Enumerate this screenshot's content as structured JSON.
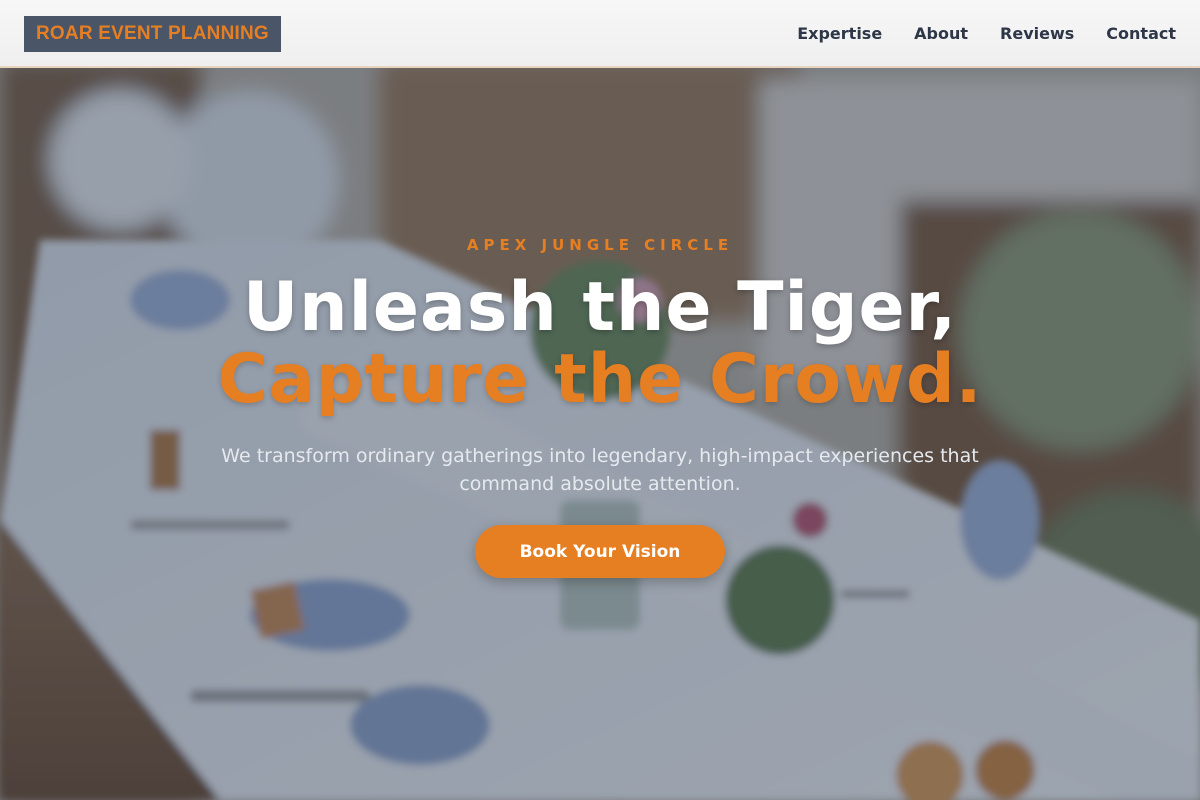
{
  "header": {
    "logo_text": "ROAR EVENT PLANNING",
    "nav": [
      {
        "label": "Expertise"
      },
      {
        "label": "About"
      },
      {
        "label": "Reviews"
      },
      {
        "label": "Contact"
      }
    ]
  },
  "hero": {
    "eyebrow": "APEX JUNGLE CIRCLE",
    "headline_line1": "Unleash the Tiger,",
    "headline_line2": "Capture the Crowd.",
    "subtitle": "We transform ordinary gatherings into legendary, high-impact experiences that command absolute attention.",
    "cta_label": "Book Your Vision",
    "background_image": "banquet table with white linens, flowers and blue gingham favors"
  },
  "colors": {
    "accent": "#e67e22",
    "logo_bg": "#4a5568",
    "nav_text": "#2d3748",
    "header_bg": "#f2f2f2",
    "overlay": "#26344a"
  }
}
